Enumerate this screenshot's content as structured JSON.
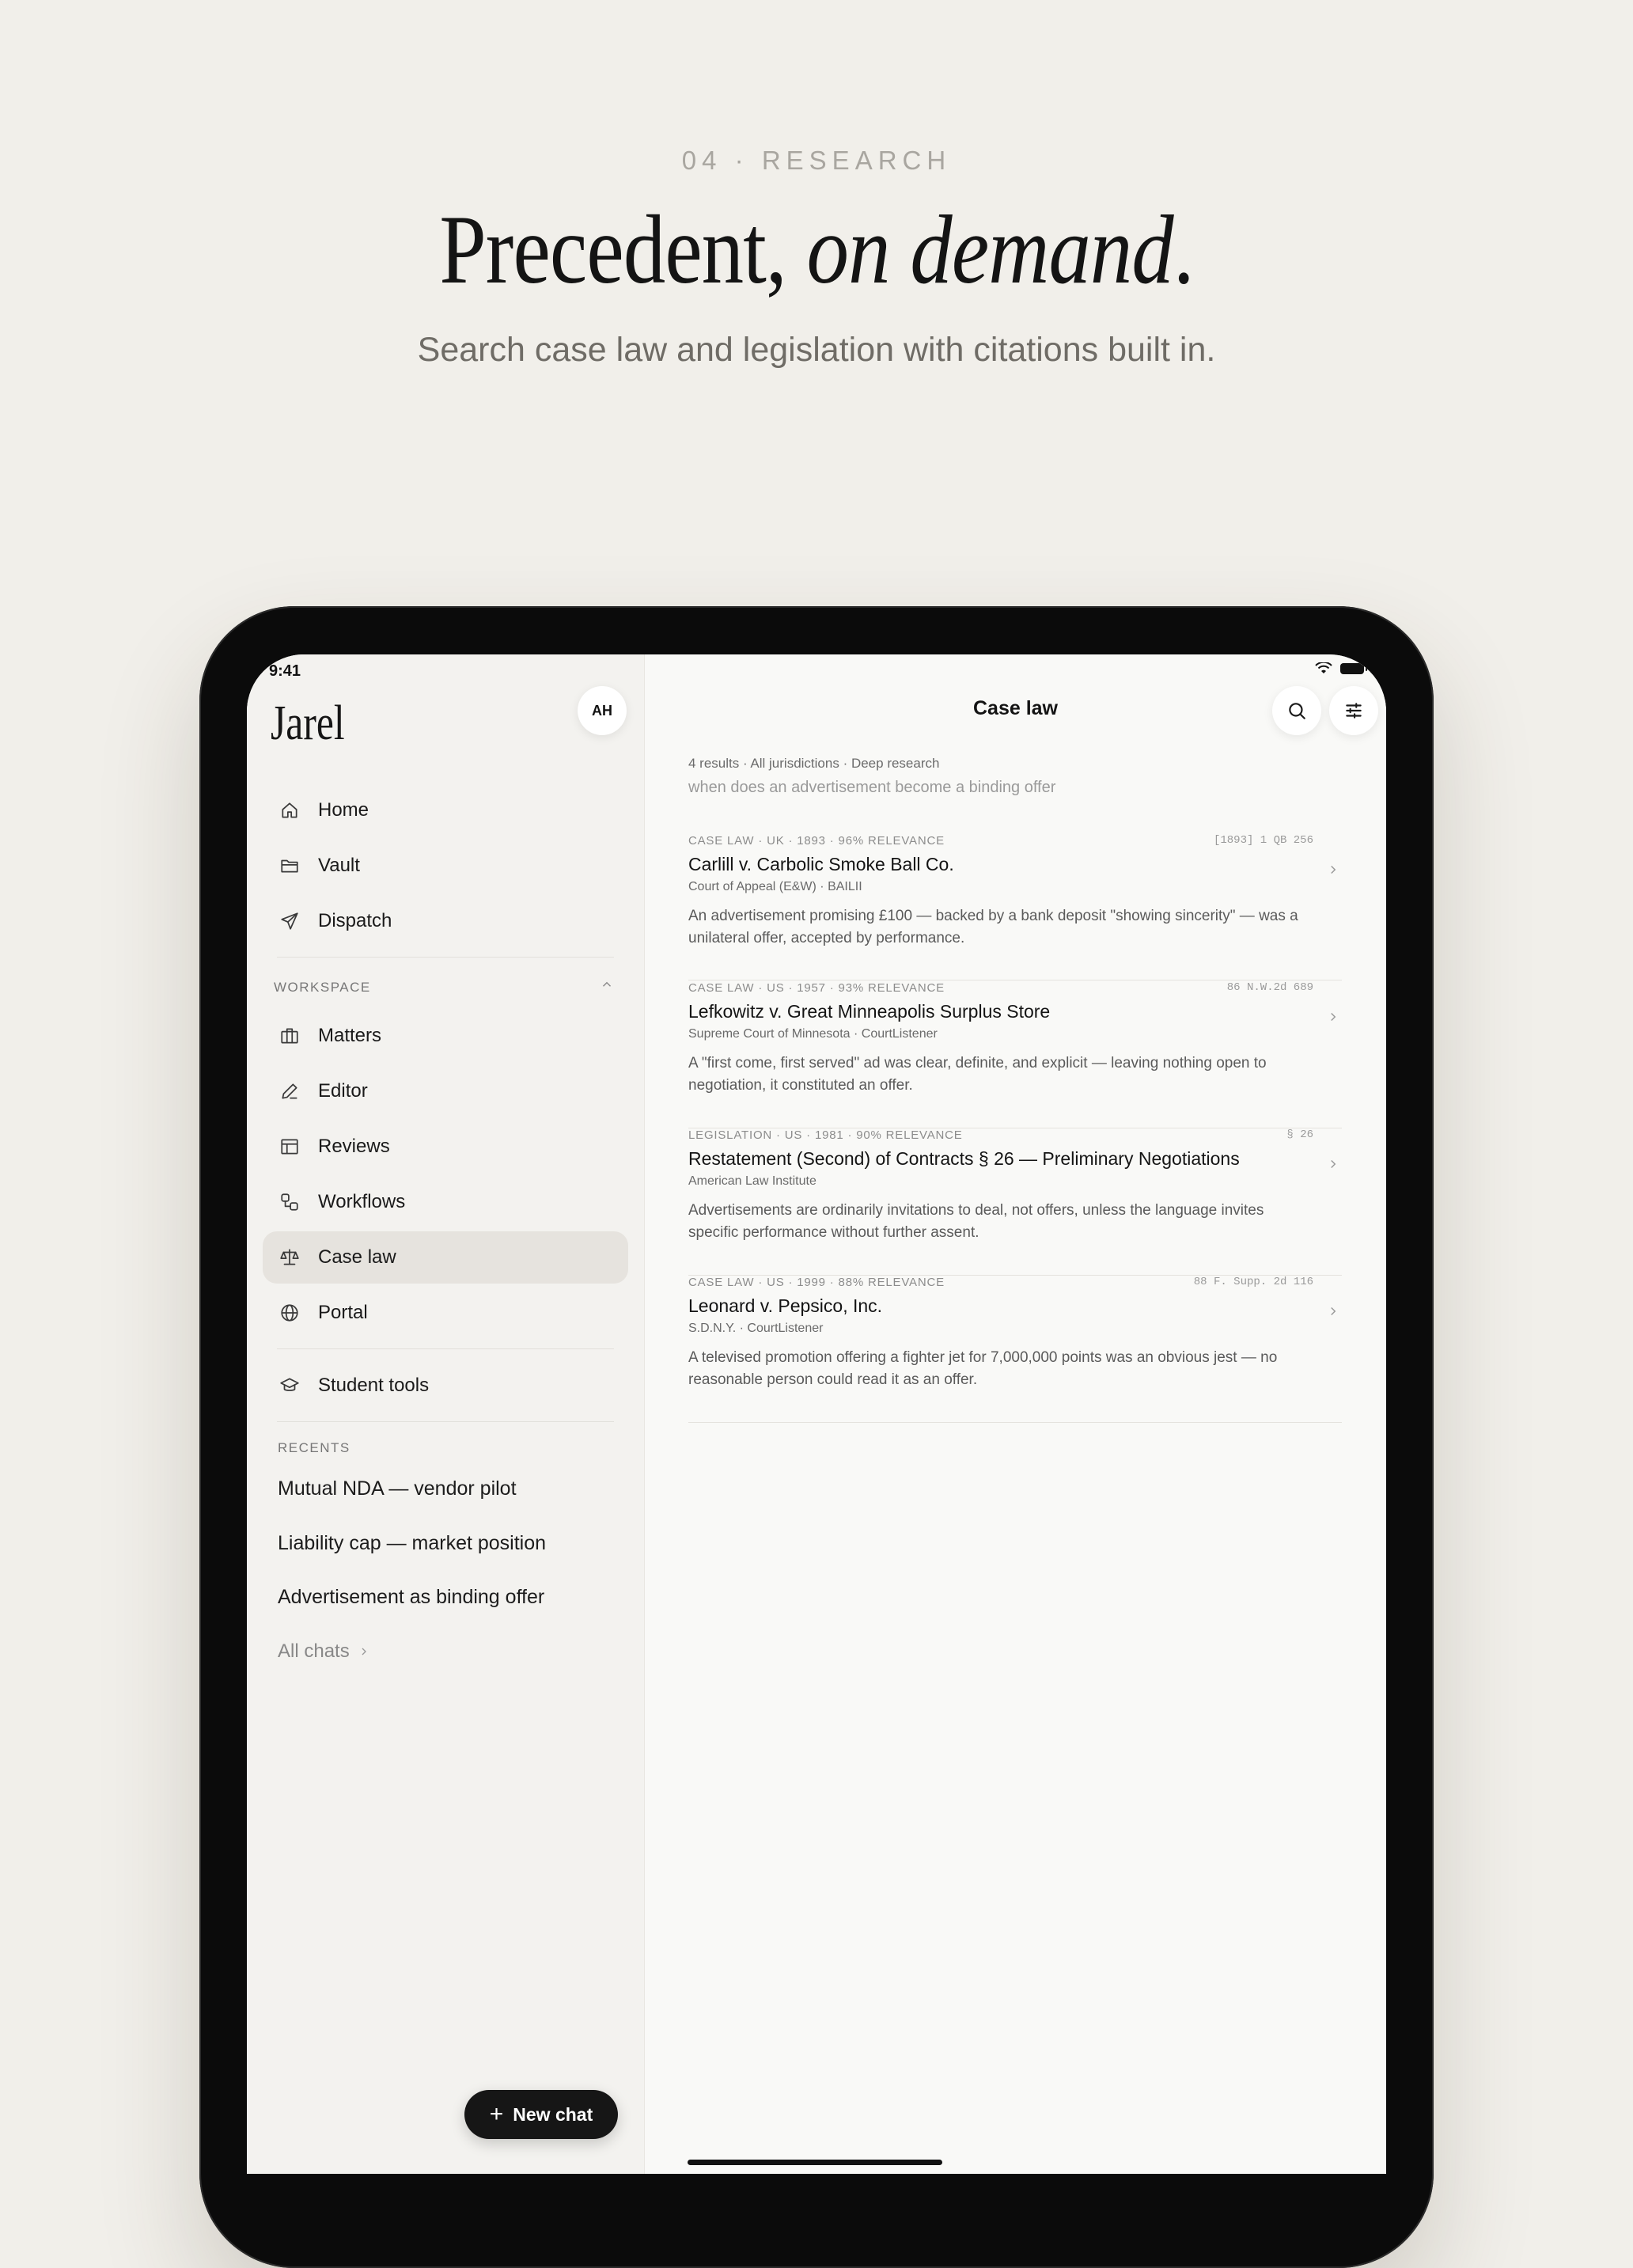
{
  "hero": {
    "eyebrow": "04 · RESEARCH",
    "headline_plain": "Precedent, ",
    "headline_italic": "on demand",
    "headline_end": ".",
    "subhead": "Search case law and legislation with citations built in."
  },
  "status": {
    "time": "9:41"
  },
  "sidebar": {
    "logo": "Jarel",
    "avatar": "AH",
    "primary": [
      {
        "label": "Home",
        "icon": "home-icon"
      },
      {
        "label": "Vault",
        "icon": "folder-icon"
      },
      {
        "label": "Dispatch",
        "icon": "send-icon"
      }
    ],
    "workspace_label": "WORKSPACE",
    "workspace": [
      {
        "label": "Matters",
        "icon": "briefcase-icon"
      },
      {
        "label": "Editor",
        "icon": "pen-icon"
      },
      {
        "label": "Reviews",
        "icon": "table-icon"
      },
      {
        "label": "Workflows",
        "icon": "workflow-icon"
      },
      {
        "label": "Case law",
        "icon": "scales-icon",
        "active": true
      },
      {
        "label": "Portal",
        "icon": "globe-icon"
      }
    ],
    "student_tools": "Student tools",
    "recents_label": "RECENTS",
    "recents": [
      "Mutual NDA — vendor pilot",
      "Liability cap — market position",
      "Advertisement as binding offer"
    ],
    "all_chats": "All chats",
    "new_chat": "New chat"
  },
  "main": {
    "title": "Case law",
    "meta": "4 results · All jurisdictions · Deep research",
    "query": "when does an advertisement become a binding offer",
    "results": [
      {
        "eyebrow": "CASE LAW · UK · 1893 · 96% RELEVANCE",
        "citation": "[1893] 1 QB 256",
        "title": "Carlill v. Carbolic Smoke Ball Co.",
        "source": "Court of Appeal (E&W) · BAILII",
        "summary": "An advertisement promising £100 — backed by a bank deposit \"showing sincerity\" — was a unilateral offer, accepted by performance."
      },
      {
        "eyebrow": "CASE LAW · US · 1957 · 93% RELEVANCE",
        "citation": "86 N.W.2d 689",
        "title": "Lefkowitz v. Great Minneapolis Surplus Store",
        "source": "Supreme Court of Minnesota · CourtListener",
        "summary": "A \"first come, first served\" ad was clear, definite, and explicit — leaving nothing open to negotiation, it constituted an offer."
      },
      {
        "eyebrow": "LEGISLATION · US · 1981 · 90% RELEVANCE",
        "citation": "§ 26",
        "title": "Restatement (Second) of Contracts § 26 — Preliminary Negotiations",
        "source": "American Law Institute",
        "summary": "Advertisements are ordinarily invitations to deal, not offers, unless the language invites specific performance without further assent."
      },
      {
        "eyebrow": "CASE LAW · US · 1999 · 88% RELEVANCE",
        "citation": "88 F. Supp. 2d 116",
        "title": "Leonard v. Pepsico, Inc.",
        "source": "S.D.N.Y. · CourtListener",
        "summary": "A televised promotion offering a fighter jet for 7,000,000 points was an obvious jest — no reasonable person could read it as an offer."
      }
    ]
  }
}
